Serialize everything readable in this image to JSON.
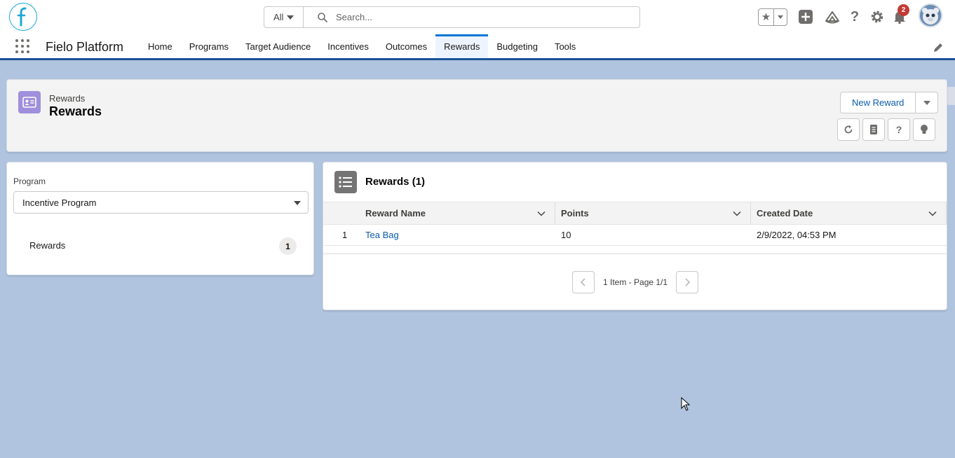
{
  "header": {
    "search_scope": "All",
    "search_placeholder": "Search...",
    "notification_count": "2"
  },
  "nav": {
    "app_name": "Fielo Platform",
    "items": [
      {
        "label": "Home"
      },
      {
        "label": "Programs"
      },
      {
        "label": "Target Audience"
      },
      {
        "label": "Incentives"
      },
      {
        "label": "Outcomes"
      },
      {
        "label": "Rewards",
        "active": true
      },
      {
        "label": "Budgeting"
      },
      {
        "label": "Tools"
      }
    ]
  },
  "page_header": {
    "object_type": "Rewards",
    "title": "Rewards",
    "new_button": "New Reward"
  },
  "filter": {
    "program_label": "Program",
    "program_value": "Incentive Program",
    "rewards_label": "Rewards",
    "rewards_count": "1"
  },
  "list": {
    "title": "Rewards (1)",
    "columns": [
      "Reward Name",
      "Points",
      "Created Date"
    ],
    "rows": [
      {
        "num": "1",
        "name": "Tea Bag",
        "points": "10",
        "created": "2/9/2022, 04:53 PM"
      }
    ],
    "pager_text": "1 Item - Page 1/1"
  },
  "colors": {
    "brand_blue": "#0176d3",
    "link": "#0b5cab",
    "rewards_icon": "#9f8fdc",
    "badge": "#c23934",
    "page_bg": "#b0c4df"
  }
}
